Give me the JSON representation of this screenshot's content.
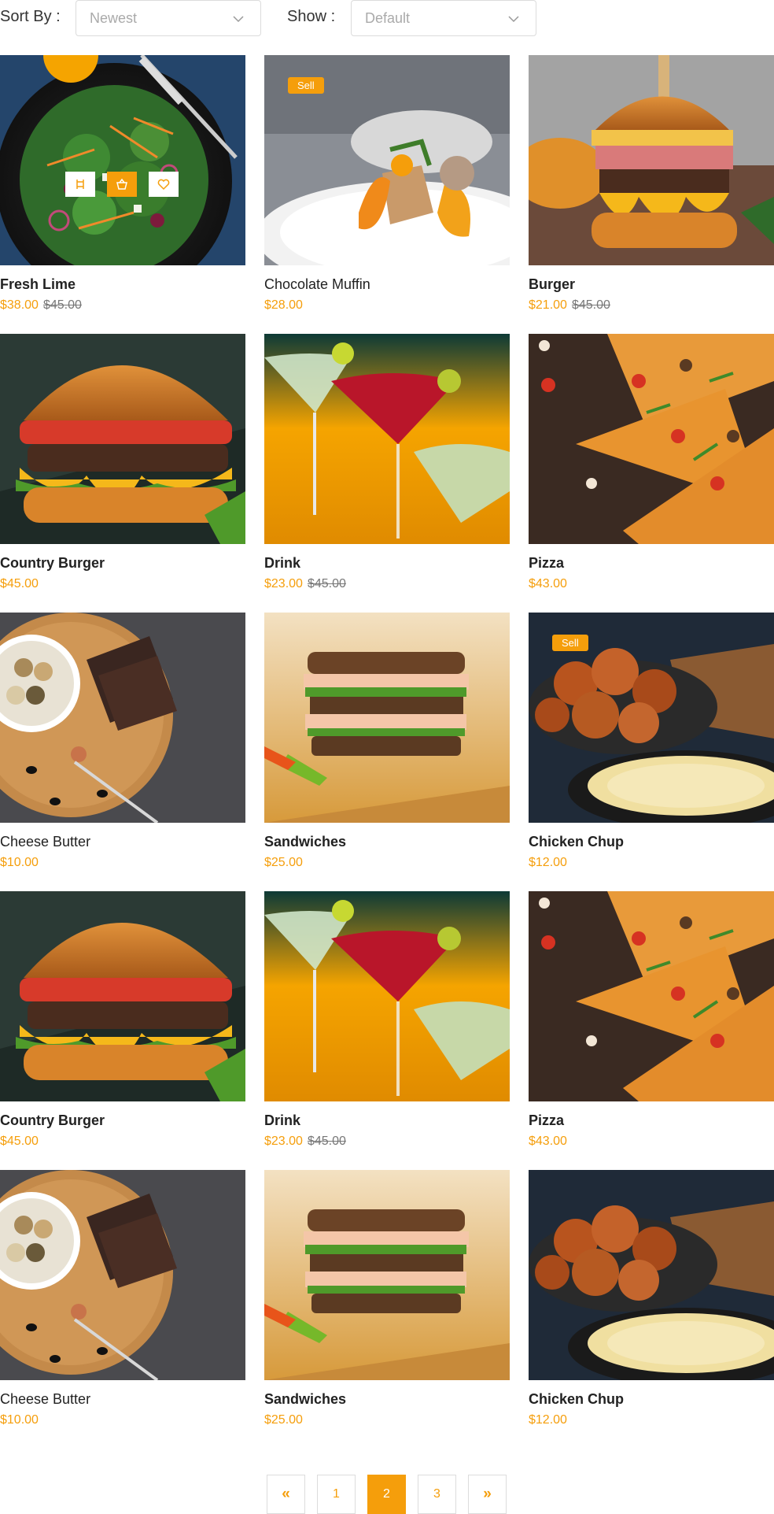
{
  "toolbar": {
    "sort_label": "Sort By :",
    "sort_value": "Newest",
    "show_label": "Show :",
    "show_value": "Default"
  },
  "products": [
    {
      "name": "Fresh Lime",
      "price": "$38.00",
      "old_price": "$45.00",
      "image": "salad-photo"
    },
    {
      "name": "Chocolate Muffin",
      "price": "$28.00",
      "old_price": "",
      "badge": "Sell",
      "image": "plated-dish-photo"
    },
    {
      "name": "Burger",
      "price": "$21.00",
      "old_price": "$45.00",
      "image": "burger-photo"
    },
    {
      "name": "Country Burger",
      "price": "$45.00",
      "old_price": "",
      "image": "country-burger-photo"
    },
    {
      "name": "Drink",
      "price": "$23.00",
      "old_price": "$45.00",
      "image": "cocktail-photo"
    },
    {
      "name": "Pizza",
      "price": "$43.00",
      "old_price": "",
      "image": "pizza-photo"
    },
    {
      "name": "Cheese Butter",
      "price": "$10.00",
      "old_price": "",
      "image": "cheese-balls-photo"
    },
    {
      "name": "Sandwiches",
      "price": "$25.00",
      "old_price": "",
      "image": "sandwich-photo"
    },
    {
      "name": "Chicken Chup",
      "price": "$12.00",
      "old_price": "",
      "badge": "Sell",
      "image": "fried-chicken-photo"
    },
    {
      "name": "Country Burger",
      "price": "$45.00",
      "old_price": "",
      "image": "country-burger-photo"
    },
    {
      "name": "Drink",
      "price": "$23.00",
      "old_price": "$45.00",
      "image": "cocktail-photo"
    },
    {
      "name": "Pizza",
      "price": "$43.00",
      "old_price": "",
      "image": "pizza-photo"
    },
    {
      "name": "Cheese Butter",
      "price": "$10.00",
      "old_price": "",
      "image": "cheese-balls-photo"
    },
    {
      "name": "Sandwiches",
      "price": "$25.00",
      "old_price": "",
      "image": "sandwich-photo"
    },
    {
      "name": "Chicken Chup",
      "price": "$12.00",
      "old_price": "",
      "image": "fried-chicken-photo"
    }
  ],
  "pagination": {
    "prev": "«",
    "pages": [
      "1",
      "2",
      "3"
    ],
    "current": "2",
    "next": "»"
  },
  "colors": {
    "accent": "#f59e0b",
    "text": "#222222",
    "muted": "#777777"
  },
  "icons": {
    "select_chevron": "chevron-down-icon",
    "quick_actions": [
      "compare-icon",
      "cart-icon",
      "heart-icon"
    ]
  }
}
